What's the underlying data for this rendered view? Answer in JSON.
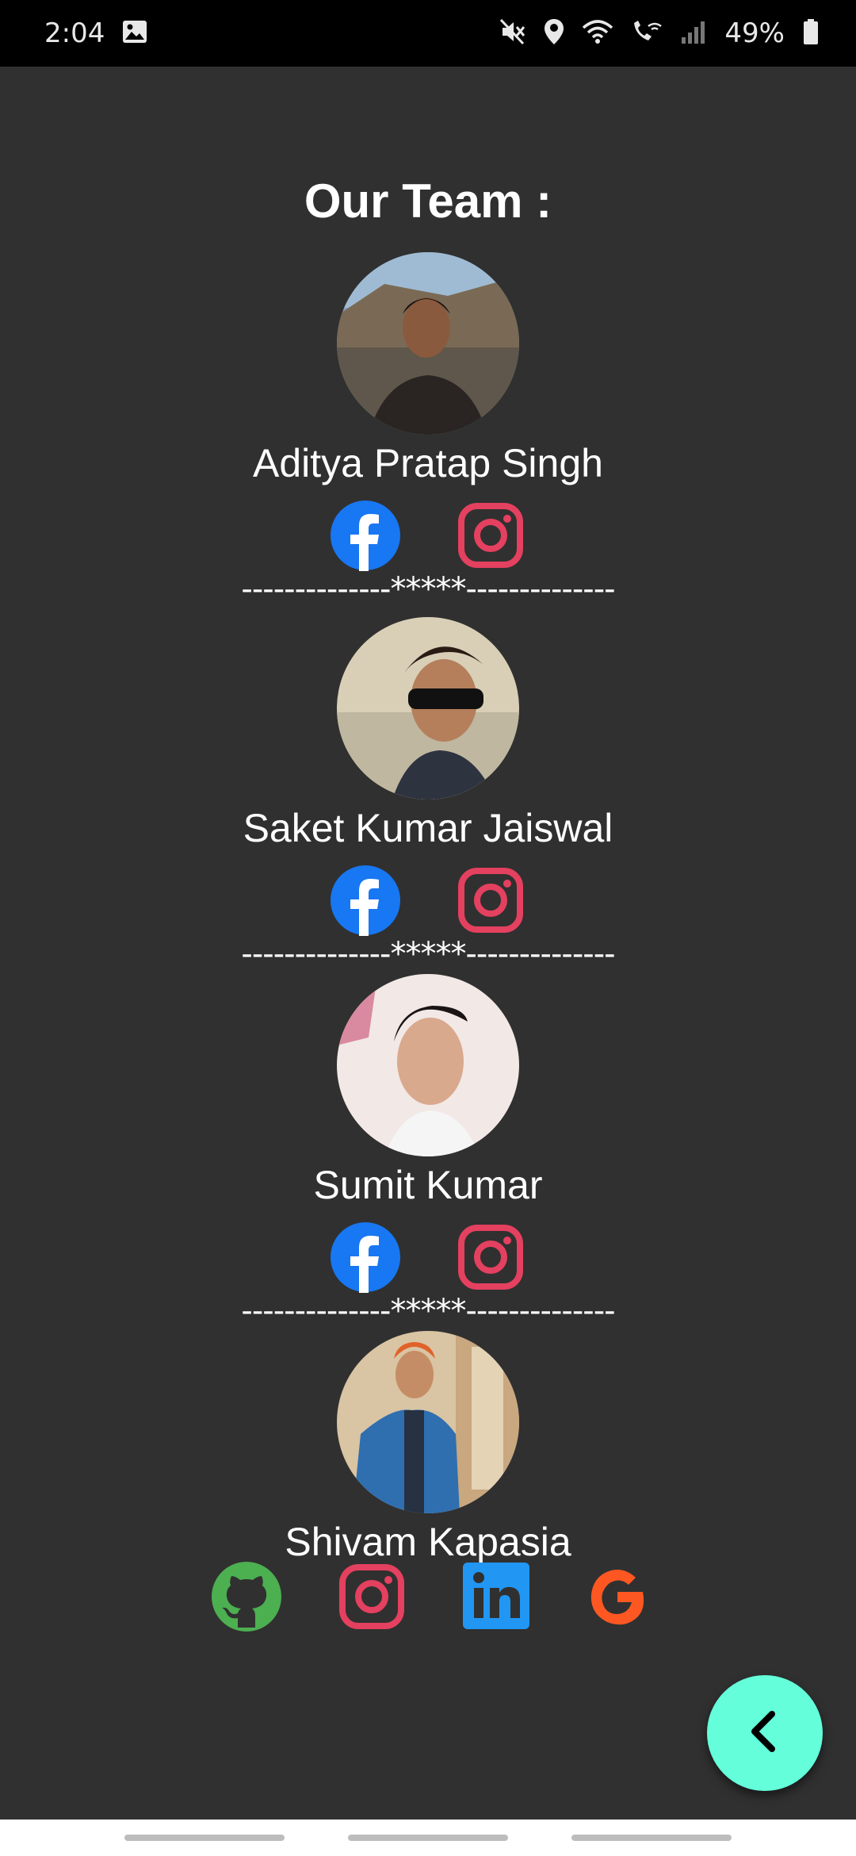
{
  "status_bar": {
    "time": "2:04",
    "battery": "49%",
    "icons": [
      "gallery-icon",
      "mute-icon",
      "location-icon",
      "wifi-icon",
      "wifi-calling-icon",
      "signal-icon",
      "battery-icon"
    ]
  },
  "title": "Our Team :",
  "members": [
    {
      "name": "Aditya Pratap Singh",
      "links": [
        "facebook-icon",
        "instagram-icon"
      ]
    },
    {
      "name": "Saket Kumar Jaiswal",
      "links": [
        "facebook-icon",
        "instagram-icon"
      ]
    },
    {
      "name": "Sumit Kumar",
      "links": [
        "facebook-icon",
        "instagram-icon"
      ]
    },
    {
      "name": "Shivam Kapasia",
      "links": [
        "github-icon",
        "instagram-icon",
        "linkedin-icon",
        "google-icon"
      ]
    }
  ],
  "divider": "--------------*****--------------",
  "fab": {
    "icon": "chevron-left-icon"
  },
  "colors": {
    "background": "#303030",
    "facebook": "#1877f2",
    "instagram": "#e4405f",
    "github": "#4caf50",
    "linkedin": "#2196f3",
    "google": "#ff5722",
    "fab": "#64ffda"
  }
}
